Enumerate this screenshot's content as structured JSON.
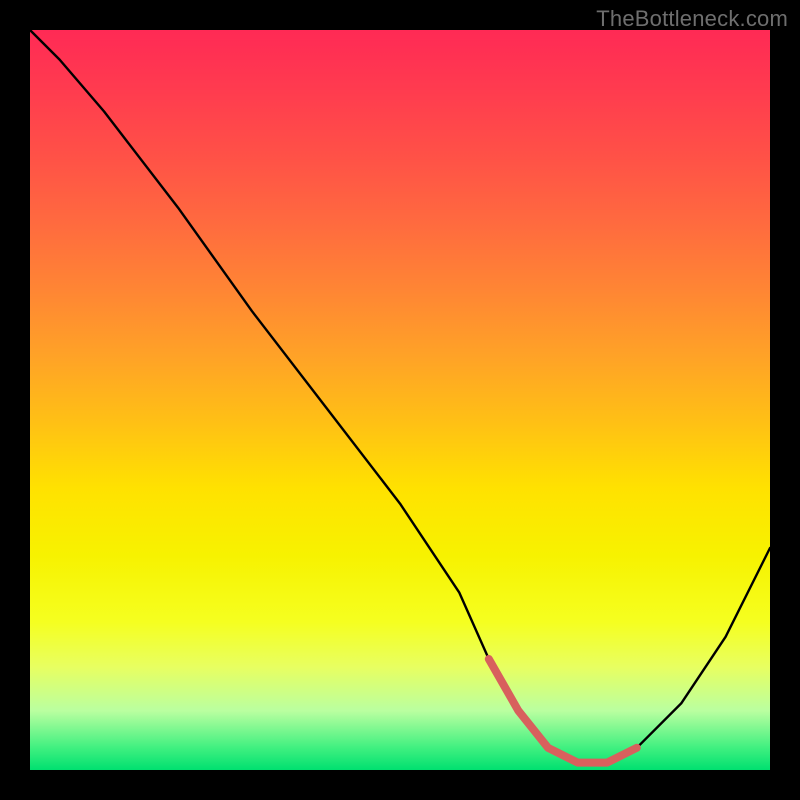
{
  "watermark": "TheBottleneck.com",
  "chart_data": {
    "type": "line",
    "title": "",
    "xlabel": "",
    "ylabel": "",
    "xlim": [
      0,
      100
    ],
    "ylim": [
      0,
      100
    ],
    "series": [
      {
        "name": "curve",
        "x": [
          0,
          4,
          10,
          20,
          30,
          40,
          50,
          58,
          62,
          66,
          70,
          74,
          78,
          82,
          88,
          94,
          100
        ],
        "y": [
          100,
          96,
          89,
          76,
          62,
          49,
          36,
          24,
          15,
          8,
          3,
          1,
          1,
          3,
          9,
          18,
          30
        ]
      }
    ],
    "highlight": {
      "name": "bottom-highlight",
      "color": "#d8605d",
      "x": [
        62,
        66,
        70,
        74,
        78,
        82
      ],
      "y": [
        15,
        8,
        3,
        1,
        1,
        3
      ]
    },
    "gradient_stops": [
      {
        "pos": 0.0,
        "color": "#ff2a55"
      },
      {
        "pos": 0.4,
        "color": "#ff8830"
      },
      {
        "pos": 0.7,
        "color": "#fff000"
      },
      {
        "pos": 0.92,
        "color": "#baffa0"
      },
      {
        "pos": 1.0,
        "color": "#00e070"
      }
    ]
  }
}
